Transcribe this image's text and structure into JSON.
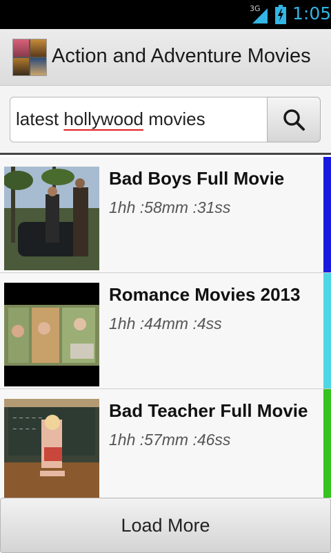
{
  "status_bar": {
    "network": "3G",
    "time": "1:05",
    "accent_color": "#33b5e5"
  },
  "app": {
    "title": "Action and Adventure Movies"
  },
  "search": {
    "value_prefix": "latest ",
    "value_misspelled": "hollywood",
    "value_suffix": " movies",
    "icon": "search-icon"
  },
  "videos": [
    {
      "title": "Bad Boys Full Movie",
      "duration": "1hh :58mm :31ss",
      "accent_color": "#1a1adf"
    },
    {
      "title": "Romance Movies 2013",
      "duration": "1hh :44mm :4ss",
      "accent_color": "#4fd6e4"
    },
    {
      "title": "Bad Teacher Full Movie",
      "duration": "1hh :57mm :46ss",
      "accent_color": "#36c21f"
    }
  ],
  "load_more": {
    "label": "Load More"
  }
}
